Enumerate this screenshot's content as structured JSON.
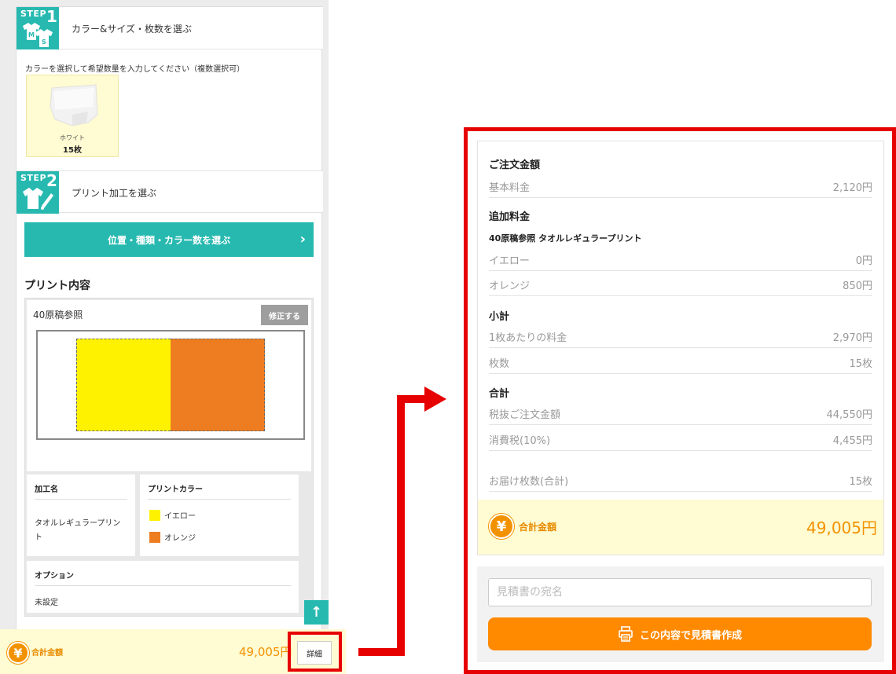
{
  "colors": {
    "accent_teal": "#27b9b0",
    "highlight_red": "#e60000",
    "total_orange": "#f39200",
    "cta_orange": "#ff8a00",
    "total_bg": "#fffbd2"
  },
  "step1": {
    "badge_step": "STEP",
    "badge_num": "1",
    "title": "カラー&サイズ・枚数を選ぶ",
    "instruction": "カラーを選択して希望数量を入力してください（複数選択可）"
  },
  "swatch": {
    "name": "ホワイト",
    "qty": "15枚"
  },
  "step2": {
    "badge_step": "STEP",
    "badge_num": "2",
    "title": "プリント加工を選ぶ",
    "choose_button": "位置・種類・カラー数を選ぶ"
  },
  "print": {
    "heading": "プリント内容",
    "label": "40原稿参照",
    "edit_button": "修正する",
    "process_header": "加工名",
    "process_value": "タオルレギュラープリント",
    "color_header": "プリントカラー",
    "colors": [
      {
        "name": "イエロー",
        "hex": "#fff200"
      },
      {
        "name": "オレンジ",
        "hex": "#ee7d21"
      }
    ],
    "option_header": "オプション",
    "option_value": "未設定"
  },
  "bottom_bar": {
    "label": "合計金額",
    "amount": "49,005円",
    "detail_button": "詳細"
  },
  "summary": {
    "order_title": "ご注文金額",
    "base_label": "基本料金",
    "base_value": "2,120円",
    "extra_title": "追加料金",
    "extra_item_title": "40原稿参照 タオルレギュラープリント",
    "yellow_label": "イエロー",
    "yellow_value": "0円",
    "orange_label": "オレンジ",
    "orange_value": "850円",
    "subtotal_title": "小計",
    "per_label": "1枚あたりの料金",
    "per_value": "2,970円",
    "count_label": "枚数",
    "count_value": "15枚",
    "total_title": "合計",
    "pretax_label": "税抜ご注文金額",
    "pretax_value": "44,550円",
    "tax_label": "消費税(10%)",
    "tax_value": "4,455円",
    "delivery_label": "お届け枚数(合計)",
    "delivery_value": "15枚",
    "grand_label": "合計金額",
    "grand_value": "49,005円"
  },
  "quote": {
    "placeholder": "見積書の宛名",
    "button": "この内容で見積書作成"
  },
  "icons": {
    "yen": "¥",
    "arrow_up": "↑",
    "chevron": "›"
  }
}
